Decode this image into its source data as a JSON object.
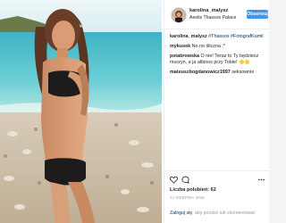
{
  "post": {
    "username": "karolina_malysz",
    "location": "Aeolis Thassos Palace",
    "follow_label": "Obserwuj"
  },
  "comments": [
    {
      "user": "karolina_malysz",
      "text": "#Thassos #FotografKamil"
    },
    {
      "user": "mykusek",
      "text": "No no ślicznа ;*"
    },
    {
      "user": "pstabrowska",
      "text": "O nie! Teraz to Ty będziesz murzyn, a ja albinos przy Tobie!"
    },
    {
      "user": "mateuszbogdanowicz1997",
      "text": "seksownie"
    }
  ],
  "actions": {
    "likes": "Liczba polubień: 62",
    "date": "12 SIERPNIA 2016",
    "login_link": "Zaloguj się",
    "login_rest": ", aby polubić lub skomentować"
  },
  "icons": [
    "avatar",
    "heart-icon",
    "comment-icon",
    "more-icon"
  ],
  "colors": {
    "follow": "#3897f0",
    "link": "#003569",
    "text": "#262626"
  }
}
